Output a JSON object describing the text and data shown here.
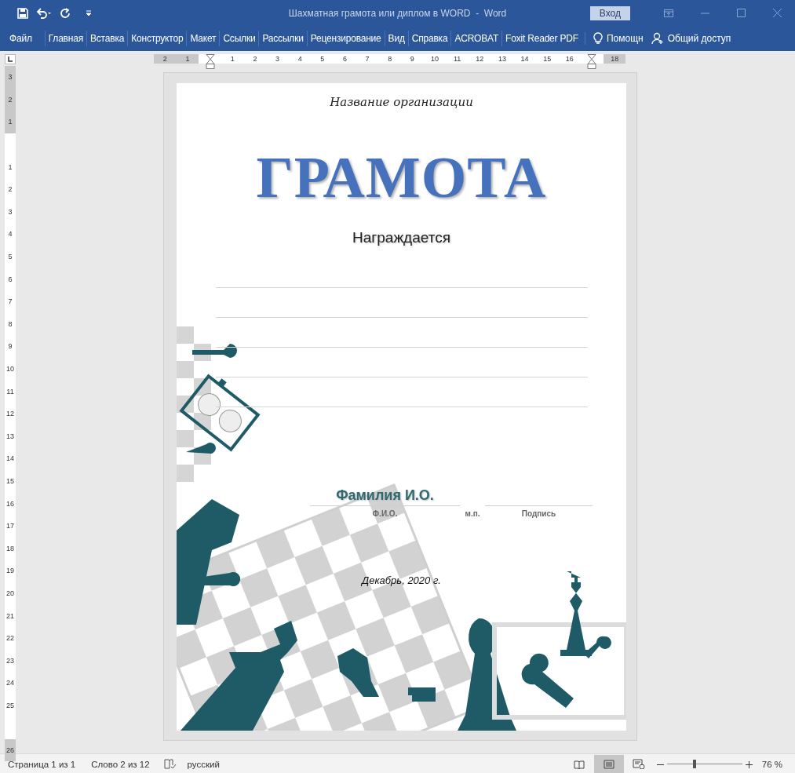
{
  "window": {
    "title": "Шахматная грамота или диплом в WORD  -  Word",
    "sign_in": "Вход"
  },
  "ribbon_tabs": [
    {
      "label": "Файл",
      "selected": false
    },
    {
      "label": "Главная",
      "selected": false
    },
    {
      "label": "Вставка",
      "selected": false
    },
    {
      "label": "Конструктор",
      "selected": false
    },
    {
      "label": "Макет",
      "selected": false
    },
    {
      "label": "Ссылки",
      "selected": false
    },
    {
      "label": "Рассылки",
      "selected": false
    },
    {
      "label": "Рецензирование",
      "selected": false
    },
    {
      "label": "Вид",
      "selected": false
    },
    {
      "label": "Справка",
      "selected": false
    },
    {
      "label": "ACROBAT",
      "selected": false
    },
    {
      "label": "Foxit Reader PDF",
      "selected": false
    }
  ],
  "help": "Помощн",
  "share": "Общий доступ",
  "ruler": {
    "horizontal": [
      {
        "kind": "number",
        "text": "2"
      },
      {
        "kind": "number",
        "text": "1"
      },
      {
        "kind": "indent"
      },
      {
        "kind": "number",
        "text": "1"
      },
      {
        "kind": "number",
        "text": "2"
      },
      {
        "kind": "number",
        "text": "3"
      },
      {
        "kind": "number",
        "text": "4"
      },
      {
        "kind": "number",
        "text": "5"
      },
      {
        "kind": "number",
        "text": "6"
      },
      {
        "kind": "number",
        "text": "7"
      },
      {
        "kind": "number",
        "text": "8"
      },
      {
        "kind": "number",
        "text": "9"
      },
      {
        "kind": "number",
        "text": "10"
      },
      {
        "kind": "number",
        "text": "11"
      },
      {
        "kind": "number",
        "text": "12"
      },
      {
        "kind": "number",
        "text": "13"
      },
      {
        "kind": "number",
        "text": "14"
      },
      {
        "kind": "number",
        "text": "15"
      },
      {
        "kind": "number",
        "text": "16"
      },
      {
        "kind": "indent"
      },
      {
        "kind": "number",
        "text": "18"
      }
    ],
    "vertical": [
      {
        "kind": "number",
        "text": "3"
      },
      {
        "kind": "number",
        "text": "2"
      },
      {
        "kind": "number",
        "text": "1"
      },
      {
        "kind": "gap"
      },
      {
        "kind": "number",
        "text": "1"
      },
      {
        "kind": "number",
        "text": "2"
      },
      {
        "kind": "number",
        "text": "3"
      },
      {
        "kind": "number",
        "text": "4"
      },
      {
        "kind": "number",
        "text": "5"
      },
      {
        "kind": "number",
        "text": "6"
      },
      {
        "kind": "number",
        "text": "7"
      },
      {
        "kind": "number",
        "text": "8"
      },
      {
        "kind": "number",
        "text": "9"
      },
      {
        "kind": "number",
        "text": "10"
      },
      {
        "kind": "number",
        "text": "11"
      },
      {
        "kind": "number",
        "text": "12"
      },
      {
        "kind": "number",
        "text": "13"
      },
      {
        "kind": "number",
        "text": "14"
      },
      {
        "kind": "number",
        "text": "15"
      },
      {
        "kind": "number",
        "text": "16"
      },
      {
        "kind": "number",
        "text": "17"
      },
      {
        "kind": "number",
        "text": "18"
      },
      {
        "kind": "number",
        "text": "19"
      },
      {
        "kind": "number",
        "text": "20"
      },
      {
        "kind": "number",
        "text": "21"
      },
      {
        "kind": "number",
        "text": "22"
      },
      {
        "kind": "number",
        "text": "23"
      },
      {
        "kind": "number",
        "text": "24"
      },
      {
        "kind": "number",
        "text": "25"
      },
      {
        "kind": "gap"
      },
      {
        "kind": "number",
        "text": "26"
      }
    ]
  },
  "document": {
    "organization": "Название организации",
    "title": "ГРАМОТА",
    "subtitle": "Награждается",
    "name": "Фамилия И.О.",
    "signature_labels": [
      "Ф.И.О.",
      "м.п.",
      "Подпись"
    ],
    "date": "Декабрь, 2020 г."
  },
  "status_bar": {
    "page": "Страница 1 из 1",
    "words": "Слово 2 из 12",
    "language": "русский",
    "view_modes": [
      {
        "kind": "read",
        "selected": false
      },
      {
        "kind": "print",
        "selected": true
      },
      {
        "kind": "web",
        "selected": false
      }
    ],
    "zoom": {
      "level": 0.37,
      "reading": "76 %"
    }
  }
}
